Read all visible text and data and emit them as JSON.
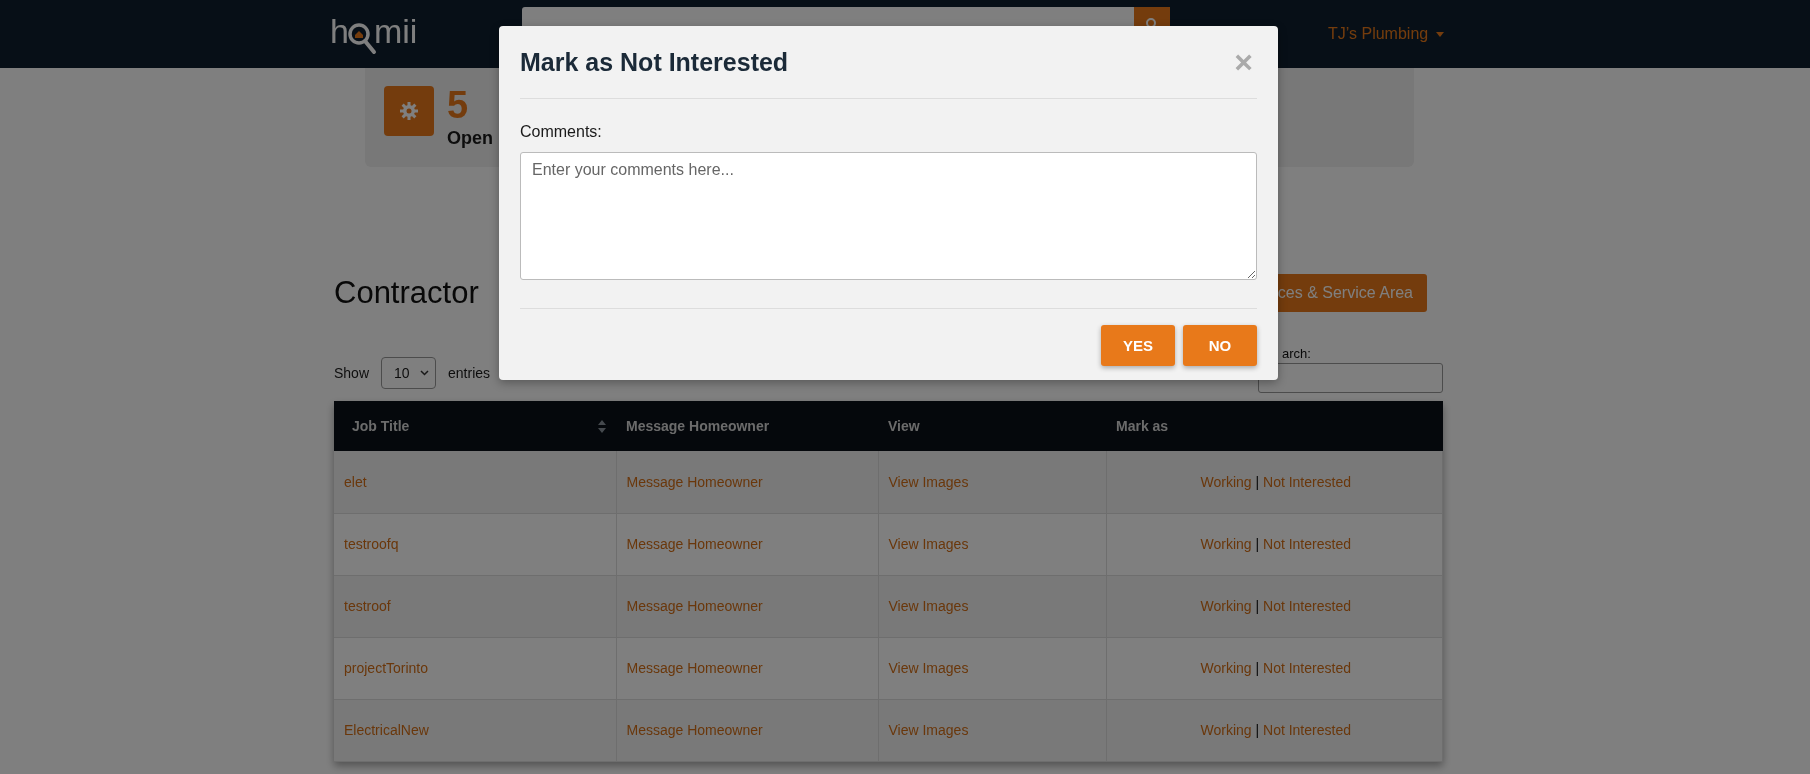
{
  "navbar": {
    "logo_start": "h",
    "logo_end": "mii",
    "account": "TJ’s Plumbing"
  },
  "stats": {
    "count": "5",
    "label": "Open"
  },
  "heading": "Contractor",
  "action_button": "ces & Service Area",
  "length_menu": {
    "label": "Show",
    "value": "10",
    "suffix": "entries"
  },
  "search_label": "arch:",
  "table": {
    "columns": [
      {
        "label": "Job Title",
        "sortable": true
      },
      {
        "label": "Message Homeowner",
        "sortable": false
      },
      {
        "label": "View",
        "sortable": false
      },
      {
        "label": "Mark as",
        "sortable": false
      }
    ],
    "rows": [
      {
        "job": "elet",
        "message": "Message Homeowner",
        "view": "View Images",
        "working": "Working",
        "separator": "|",
        "not_interested": "Not Interested"
      },
      {
        "job": "testroofq",
        "message": "Message Homeowner",
        "view": "View Images",
        "working": "Working",
        "separator": "|",
        "not_interested": "Not Interested"
      },
      {
        "job": "testroof",
        "message": "Message Homeowner",
        "view": "View Images",
        "working": "Working",
        "separator": "|",
        "not_interested": "Not Interested"
      },
      {
        "job": "projectTorinto",
        "message": "Message Homeowner",
        "view": "View Images",
        "working": "Working",
        "separator": "|",
        "not_interested": "Not Interested"
      },
      {
        "job": "ElectricalNew",
        "message": "Message Homeowner",
        "view": "View Images",
        "working": "Working",
        "separator": "|",
        "not_interested": "Not Interested"
      }
    ]
  },
  "modal": {
    "title": "Mark as Not Interested",
    "close": "×",
    "comments_label": "Comments:",
    "placeholder": "Enter your comments here...",
    "buttons": [
      "YES",
      "NO"
    ]
  }
}
